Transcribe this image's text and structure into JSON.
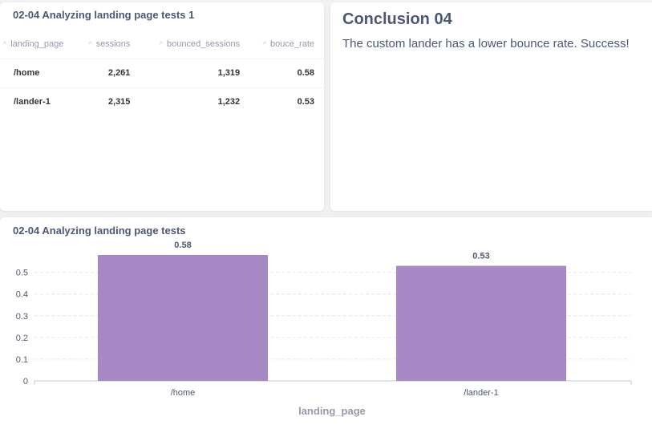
{
  "table_card": {
    "title": "02-04 Analyzing landing page tests 1",
    "columns": [
      "landing_page",
      "sessions",
      "bounced_sessions",
      "bouce_rate"
    ],
    "rows": [
      [
        "/home",
        "2,261",
        "1,319",
        "0.58"
      ],
      [
        "/lander-1",
        "2,315",
        "1,232",
        "0.53"
      ]
    ]
  },
  "text_card": {
    "title": "Conclusion 04",
    "body": "The custom lander has a lower bounce rate. Success!"
  },
  "chart_card": {
    "title": "02-04 Analyzing landing page tests"
  },
  "chart_data": {
    "type": "bar",
    "title": "02-04 Analyzing landing page tests",
    "categories": [
      "/home",
      "/lander-1"
    ],
    "values": [
      0.58,
      0.53
    ],
    "data_labels": [
      "0.58",
      "0.53"
    ],
    "xlabel": "landing_page",
    "ylabel": "",
    "ylim": [
      0,
      0.58
    ],
    "yticks": [
      0,
      0.1,
      0.2,
      0.3,
      0.4,
      0.5
    ],
    "ytick_labels": [
      "0",
      "0.1",
      "0.2",
      "0.3",
      "0.4",
      "0.5"
    ],
    "grid": true,
    "bar_color": "#a688c5"
  }
}
